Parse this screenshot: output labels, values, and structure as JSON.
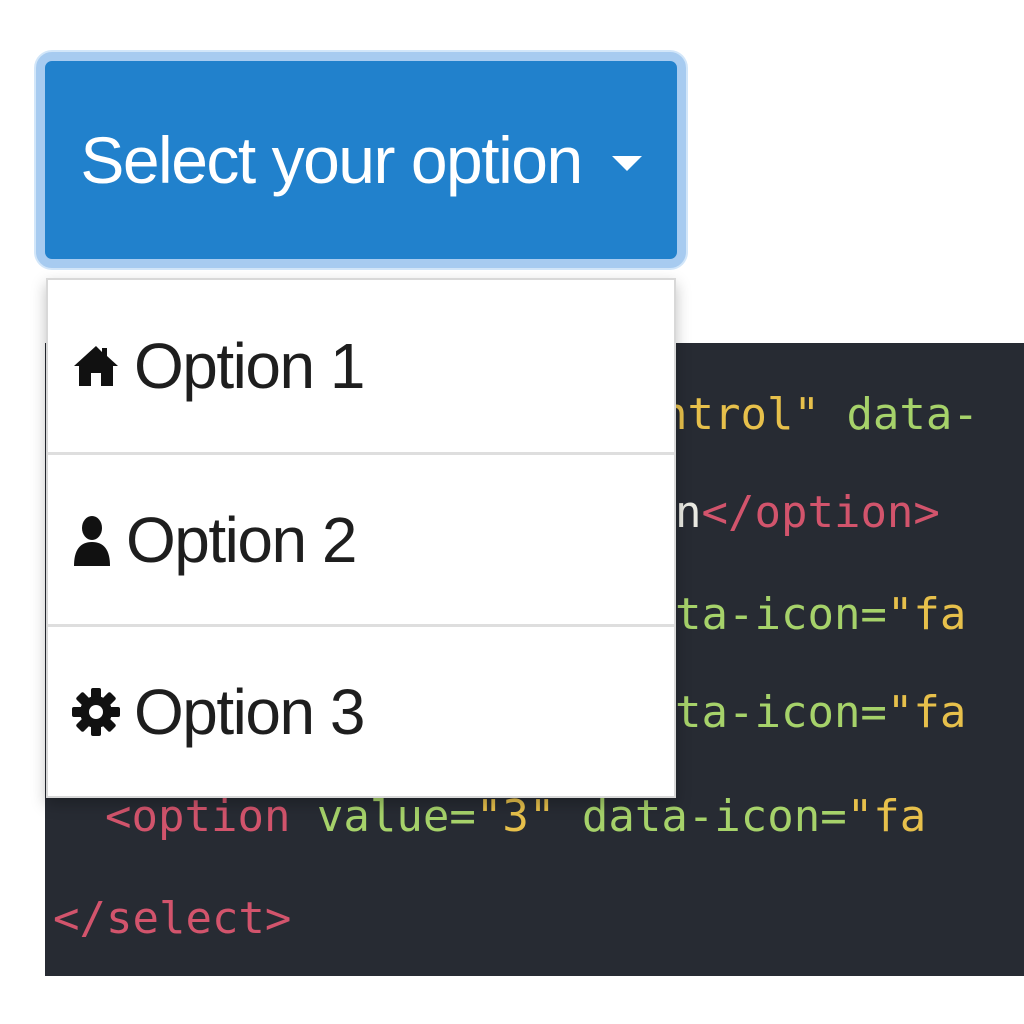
{
  "dropdown": {
    "toggle_label": "Select your option",
    "caret_icon": "caret-down-icon",
    "accent_color": "#2181cc"
  },
  "menu": {
    "items": [
      {
        "label": "Option 1",
        "icon": "home-icon"
      },
      {
        "label": "Option 2",
        "icon": "user-icon"
      },
      {
        "label": "Option 3",
        "icon": "gear-icon"
      }
    ]
  },
  "code": {
    "line1": {
      "c1": "ntrol\"",
      "c2": " data-"
    },
    "line2": {
      "c1": "n",
      "c2": "</option>"
    },
    "line3": {
      "c1": "ta-icon=",
      "c2": "\"fa"
    },
    "line4": {
      "c1": "ta-icon=",
      "c2": "\"fa"
    },
    "line5": {
      "c1": "<option",
      "c2": " value=",
      "c3": "\"3\"",
      "c4": " data-icon=",
      "c5": "\"fa"
    },
    "line6": {
      "c1": "</select>"
    }
  },
  "colors": {
    "code_bg": "#272b33",
    "tag": "#d2546c",
    "attr": "#a6d26a",
    "string": "#e7c04b"
  }
}
